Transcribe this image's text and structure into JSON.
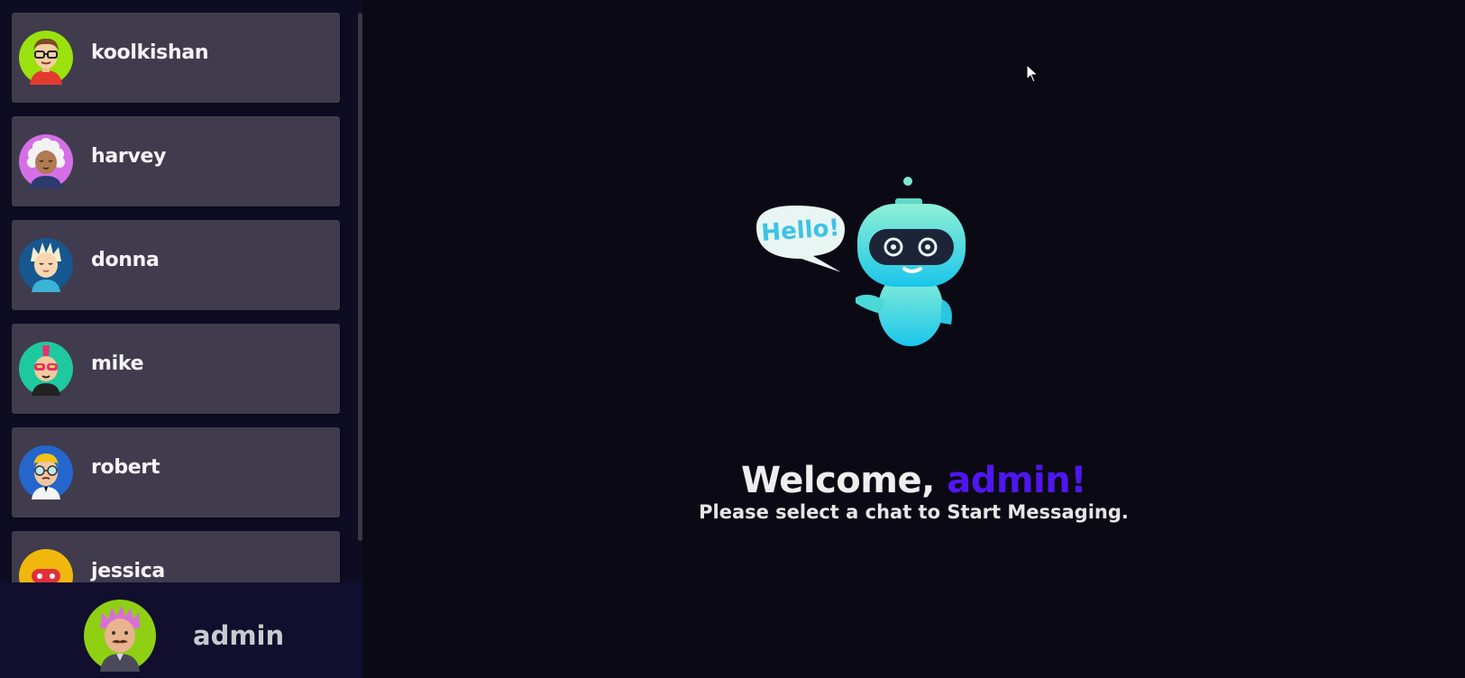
{
  "contacts": [
    {
      "name": "koolkishan",
      "avatar": "cartoon-man-glasses-avatar-icon"
    },
    {
      "name": "harvey",
      "avatar": "curly-white-hair-avatar-icon"
    },
    {
      "name": "donna",
      "avatar": "spiky-hair-avatar-icon"
    },
    {
      "name": "mike",
      "avatar": "mohawk-sunglasses-avatar-icon"
    },
    {
      "name": "robert",
      "avatar": "blond-glasses-avatar-icon"
    },
    {
      "name": "jessica",
      "avatar": "yellow-robot-avatar-icon"
    }
  ],
  "current_user": {
    "name": "admin",
    "avatar": "pink-hair-mustache-avatar-icon"
  },
  "welcome": {
    "prefix": "Welcome, ",
    "username": "admin!",
    "subtitle": "Please select a chat to Start Messaging."
  },
  "robot": {
    "speech_text": "Hello!"
  },
  "colors": {
    "sidebar_bg": "#0e0c23",
    "contact_card": "#403c4d",
    "main_bg": "#0b0a14",
    "accent": "#4f16f0"
  }
}
